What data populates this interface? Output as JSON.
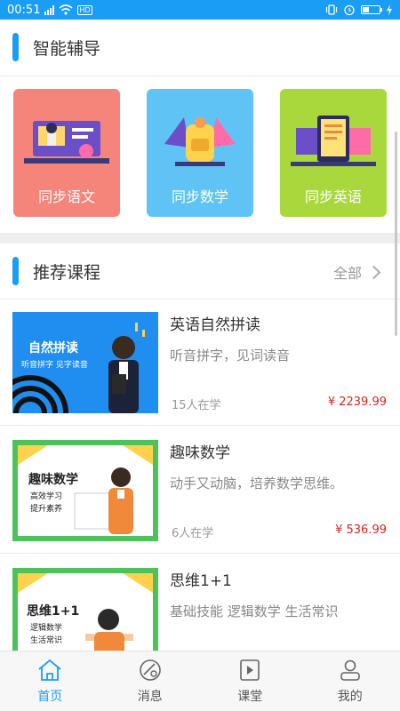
{
  "status_bar": {
    "time": "00:51",
    "network": "HD"
  },
  "tutoring": {
    "title": "智能辅导",
    "cards": [
      {
        "label": "同步语文",
        "color": "#f5857a"
      },
      {
        "label": "同步数学",
        "color": "#5fc4f5"
      },
      {
        "label": "同步英语",
        "color": "#a8d83c"
      }
    ]
  },
  "recommended": {
    "title": "推荐课程",
    "more_label": "全部",
    "courses": [
      {
        "title": "英语自然拼读",
        "desc": "听音拼字，见词读音",
        "students": "15人在学",
        "price": "¥ 2239.99",
        "thumb_title": "自然拼读",
        "thumb_sub": "听音拼字 见字读音"
      },
      {
        "title": "趣味数学",
        "desc": "动手又动脑，培养数学思维。",
        "students": "6人在学",
        "price": "¥ 536.99",
        "thumb_title": "趣味数学",
        "thumb_sub": "高效学习",
        "thumb_sub2": "提升素养"
      },
      {
        "title": "思维1+1",
        "desc": "基础技能 逻辑数学 生活常识",
        "students": "",
        "price": "",
        "thumb_title": "思维1+1",
        "thumb_sub": "逻辑数学",
        "thumb_sub2": "生活常识"
      }
    ]
  },
  "tabbar": {
    "items": [
      {
        "label": "首页",
        "icon": "home-icon",
        "active": true
      },
      {
        "label": "消息",
        "icon": "message-icon",
        "active": false
      },
      {
        "label": "课堂",
        "icon": "classroom-icon",
        "active": false
      },
      {
        "label": "我的",
        "icon": "profile-icon",
        "active": false
      }
    ]
  }
}
